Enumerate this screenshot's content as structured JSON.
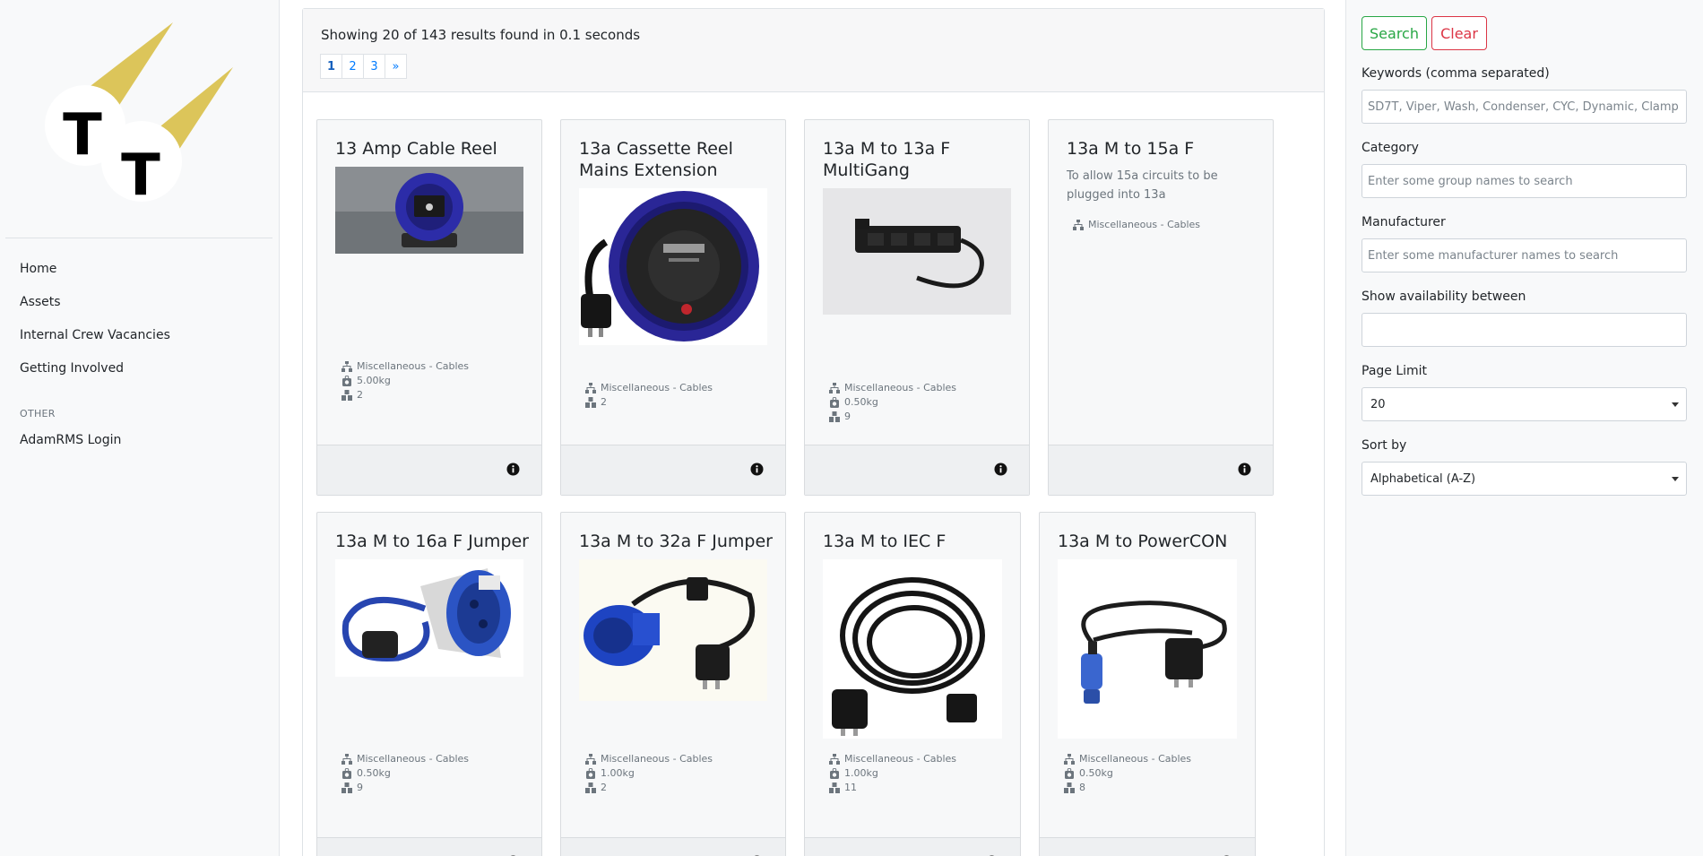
{
  "sidebar": {
    "logo_letters": [
      "T",
      "T"
    ],
    "nav": [
      {
        "label": "Home"
      },
      {
        "label": "Assets"
      },
      {
        "label": "Internal Crew Vacancies"
      },
      {
        "label": "Getting Involved"
      }
    ],
    "other_heading": "OTHER",
    "other_nav": [
      {
        "label": "AdamRMS Login"
      }
    ]
  },
  "results": {
    "summary": "Showing 20 of 143 results found in 0.1 seconds",
    "pages": [
      "1",
      "2",
      "3",
      "»"
    ],
    "active_page": "1"
  },
  "assets": [
    {
      "title": "13 Amp Cable Reel",
      "category": "Miscellaneous - Cables",
      "weight": "5.00kg",
      "quantity": "2",
      "image": "cable-reel-photo"
    },
    {
      "title": "13a Cassette Reel Mains Extension",
      "category": "Miscellaneous - Cables",
      "quantity": "2",
      "image": "cassette-reel-photo"
    },
    {
      "title": "13a M to 13a F MultiGang",
      "category": "Miscellaneous - Cables",
      "weight": "0.50kg",
      "quantity": "9",
      "image": "multigang-photo"
    },
    {
      "title": "13a M to 15a F",
      "description": "To allow 15a circuits to be plugged into 13a",
      "category": "Miscellaneous - Cables"
    },
    {
      "title": "13a M to 16a F Jumper",
      "category": "Miscellaneous - Cables",
      "weight": "0.50kg",
      "quantity": "9",
      "image": "16a-jumper-photo"
    },
    {
      "title": "13a M to 32a F Jumper",
      "category": "Miscellaneous - Cables",
      "weight": "1.00kg",
      "quantity": "2",
      "image": "32a-jumper-photo"
    },
    {
      "title": "13a M to IEC F",
      "category": "Miscellaneous - Cables",
      "weight": "1.00kg",
      "quantity": "11",
      "image": "iec-cable-photo"
    },
    {
      "title": "13a M to PowerCON",
      "category": "Miscellaneous - Cables",
      "weight": "0.50kg",
      "quantity": "8",
      "image": "powercon-cable-photo"
    }
  ],
  "filters": {
    "search_label": "Search",
    "clear_label": "Clear",
    "keywords_label": "Keywords (comma separated)",
    "keywords_placeholder": "SD7T, Viper, Wash, Condenser, CYC, Dynamic, Clamp",
    "category_label": "Category",
    "category_placeholder": "Enter some group names to search",
    "manufacturer_label": "Manufacturer",
    "manufacturer_placeholder": "Enter some manufacturer names to search",
    "availability_label": "Show availability between",
    "availability_value": "",
    "page_limit_label": "Page Limit",
    "page_limit_value": "20",
    "sort_label": "Sort by",
    "sort_value": "Alphabetical (A-Z)"
  },
  "colors": {
    "logo_yellow": "#dcc55a",
    "search_green": "#28a745",
    "clear_red": "#dc3545",
    "link_blue": "#007bff"
  }
}
